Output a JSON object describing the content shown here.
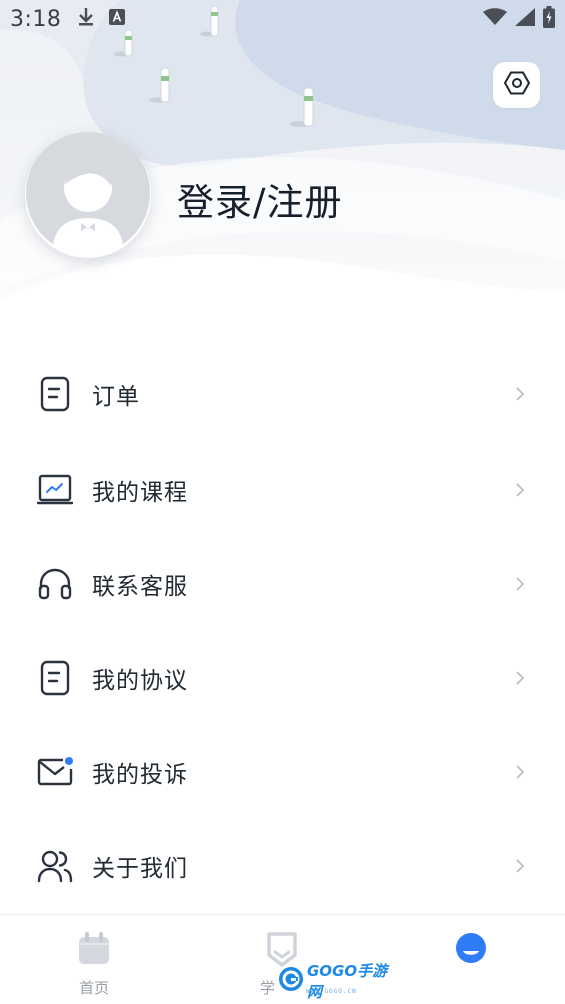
{
  "status_bar": {
    "time": "3:18",
    "left_icons": [
      "download-icon",
      "text-a-icon"
    ],
    "right_icons": [
      "wifi-icon",
      "signal-icon",
      "battery-charging-icon"
    ]
  },
  "header": {
    "settings_icon": "settings-hex-icon",
    "avatar_icon": "default-avatar-icon",
    "login_label": "登录/注册"
  },
  "menu": {
    "items": [
      {
        "label": "订单",
        "icon": "document-icon"
      },
      {
        "label": "我的课程",
        "icon": "chart-board-icon"
      },
      {
        "label": "联系客服",
        "icon": "headphones-icon"
      },
      {
        "label": "我的协议",
        "icon": "document-icon"
      },
      {
        "label": "我的投诉",
        "icon": "mail-icon"
      },
      {
        "label": "关于我们",
        "icon": "users-icon"
      }
    ]
  },
  "bottom_nav": {
    "tabs": [
      {
        "label": "首页",
        "icon": "calendar-icon",
        "active": false
      },
      {
        "label": "学",
        "icon": "shield-icon",
        "active": false
      },
      {
        "label": "",
        "icon": "mine-icon",
        "active": true
      }
    ]
  },
  "watermark": {
    "text": "GOGO手游网",
    "sub": "WWW.GOGO.CN"
  },
  "colors": {
    "accent": "#2f7cf6",
    "icon_stroke": "#2b3340",
    "text_primary": "#1f2a37",
    "nav_inactive": "#c7cbd1"
  }
}
